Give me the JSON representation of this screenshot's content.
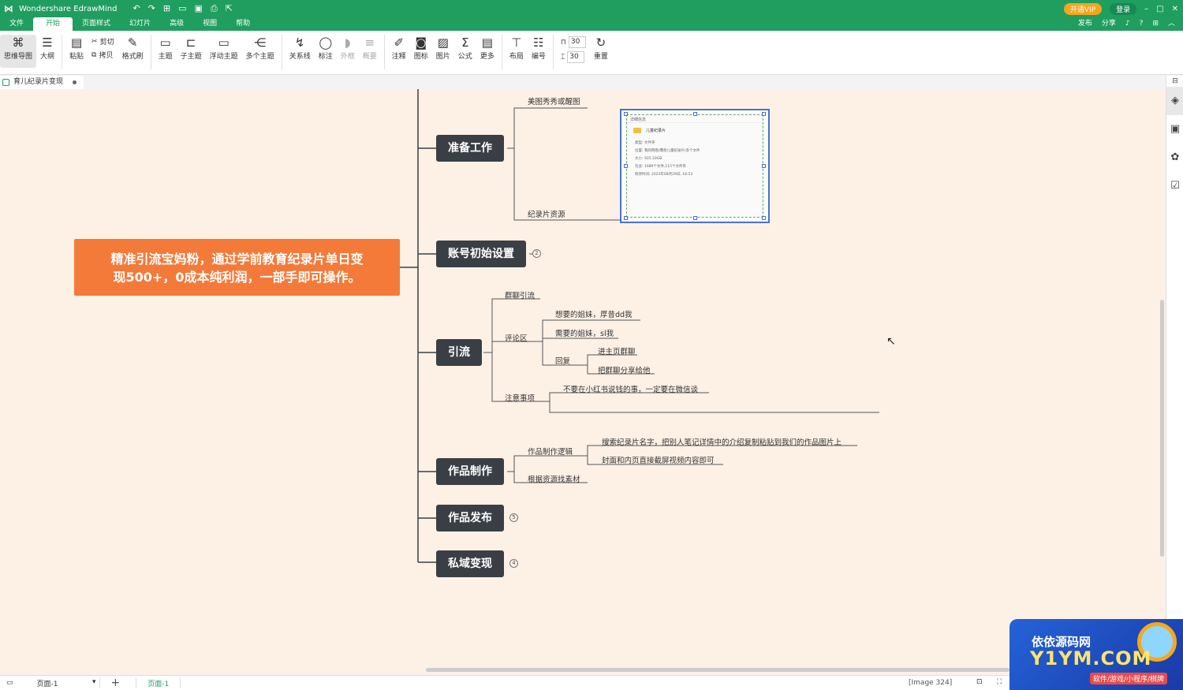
{
  "app": {
    "title": "Wondershare EdrawMind",
    "vip": "开通VIP",
    "login": "登录",
    "publish": "发布",
    "share": "分享"
  },
  "menu": [
    "文件",
    "开始",
    "页面样式",
    "幻灯片",
    "高级",
    "视图",
    "帮助"
  ],
  "ribbon": {
    "mindmap": "思维导图",
    "outline": "大纲",
    "paste": "粘贴",
    "cut": "剪切",
    "copy": "拷贝",
    "format_painter": "格式刷",
    "topic": "主题",
    "subtopic": "子主题",
    "floating": "浮动主题",
    "multi": "多个主题",
    "relation": "关系线",
    "callout": "标注",
    "boundary": "外框",
    "summary": "概要",
    "note": "注释",
    "icon": "图标",
    "picture": "图片",
    "formula": "公式",
    "more": "更多",
    "layout": "布局",
    "numbering": "编号",
    "spacing_h": "30",
    "spacing_v": "30",
    "reset": "重置"
  },
  "doc_tab": "育儿纪录片变现",
  "root": {
    "line1": "精准引流宝妈粉，通过学前教育纪录片单日变",
    "line2": "现500+，0成本纯利润，一部手即可操作。"
  },
  "topics": {
    "prep": "准备工作",
    "account": "账号初始设置",
    "traffic": "引流",
    "production": "作品制作",
    "publish": "作品发布",
    "monetize": "私域变现"
  },
  "badges": {
    "account": "2",
    "publish": "5",
    "monetize": "4"
  },
  "subs": {
    "meitu": "美图秀秀或醒图",
    "resources": "纪录片资源",
    "group": "群聊引流",
    "comments": "评论区",
    "want_sisters": "想要的姐妹，厚昔dd我",
    "need_sisters": "需要的姐妹，sl我",
    "reply": "回复",
    "homepage_group": "进主页群聊",
    "share_group": "把群聊分享给他",
    "notes": "注意事项",
    "no_money": "不要在小红书说钱的事，一定要在微信谈",
    "logic": "作品制作逻辑",
    "search_doc": "搜索纪录片名字，把别人笔记详情中的介绍复制粘贴到我们的作品图片上",
    "cover": "封面和内页直接截屏视频内容即可",
    "find_material": "根据资源找素材"
  },
  "embedded_image": {
    "header": "详细信息",
    "folder": "儿童纪录片",
    "rows": [
      [
        "类型:",
        "文件夹"
      ],
      [
        "位置:",
        "我的网盘/爆款儿童纪录片/多个文件"
      ],
      [
        "大小:",
        "925.10GB"
      ],
      [
        "包含:",
        "1689个文件,115个文件夹"
      ],
      [
        "修改时间:",
        "2023年08月29日, 18:53"
      ]
    ]
  },
  "statusbar": {
    "page_select": "页面-1",
    "page_tab": "页面-1",
    "image_info": "[Image 324]"
  },
  "watermark": {
    "line1": "依依源码网",
    "line2": "Y1YM.COM",
    "line3": "软件/游戏/小程序/棋牌"
  },
  "colors": {
    "brand_green": "#1f9e5f",
    "root_orange": "#f47a3a",
    "topic_dark": "#3a3f45",
    "canvas_bg": "#fdf1e6"
  }
}
